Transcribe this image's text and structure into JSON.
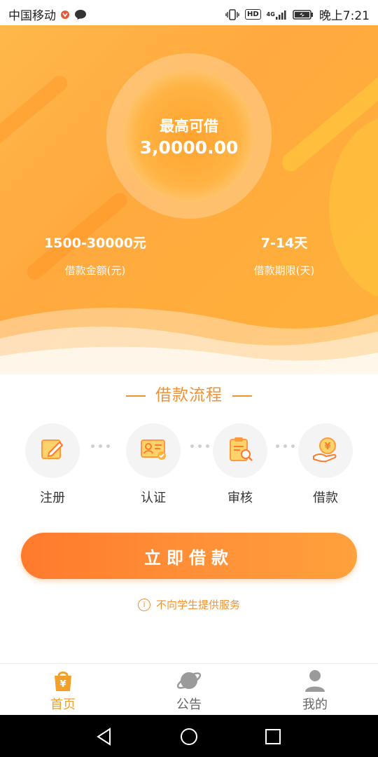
{
  "status_bar": {
    "carrier": "中国移动",
    "time": "晚上7:21",
    "hd_label": "HD",
    "network_label": "4G"
  },
  "hero": {
    "circle_title": "最高可借",
    "circle_amount": "3,0000.00",
    "left_stat": {
      "value": "1500-30000元",
      "label": "借款金额(元)"
    },
    "right_stat": {
      "value": "7-14天",
      "label": "借款期限(天)"
    },
    "colors": {
      "primary": "#ffa93e",
      "accent": "#ff7a2d"
    }
  },
  "process": {
    "title": "借款流程",
    "steps": [
      {
        "label": "注册",
        "icon": "edit-icon"
      },
      {
        "label": "认证",
        "icon": "id-card-icon"
      },
      {
        "label": "审核",
        "icon": "clipboard-search-icon"
      },
      {
        "label": "借款",
        "icon": "coin-hand-icon"
      }
    ]
  },
  "cta": {
    "label": "立即借款"
  },
  "notice": {
    "text": "不向学生提供服务",
    "icon": "info-icon"
  },
  "tabbar": {
    "tabs": [
      {
        "label": "首页",
        "icon": "home-bag-icon",
        "active": true
      },
      {
        "label": "公告",
        "icon": "planet-icon",
        "active": false
      },
      {
        "label": "我的",
        "icon": "user-icon",
        "active": false
      }
    ]
  },
  "navbar": {
    "buttons": [
      "back-icon",
      "home-icon",
      "recents-icon"
    ]
  }
}
